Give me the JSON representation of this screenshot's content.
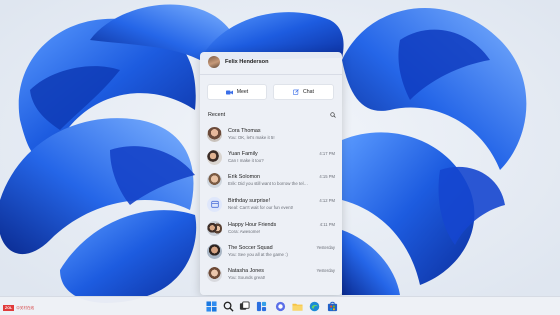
{
  "user": {
    "name": "Felix Henderson"
  },
  "actions": {
    "meet_label": "Meet",
    "chat_label": "Chat"
  },
  "recent": {
    "title": "Recent"
  },
  "chats": [
    {
      "name": "Cora Thomas",
      "message": "You: OK, let's make it 5!",
      "time": ""
    },
    {
      "name": "Yuan Family",
      "message": "Can I make it too?",
      "time": "4:17 PM"
    },
    {
      "name": "Erik Solomon",
      "message": "Erik: Did you still want to borrow the telec?",
      "time": "4:15 PM"
    },
    {
      "name": "Birthday surprise!",
      "message": "Neal: Can't wait for our fun event!",
      "time": "4:12 PM"
    },
    {
      "name": "Happy Hour Friends",
      "message": "Cora: Awesome!",
      "time": "4:11 PM"
    },
    {
      "name": "The Soccer Squad",
      "message": "You: See you all at the game :)",
      "time": "Yesterday"
    },
    {
      "name": "Natasha Jones",
      "message": "You: Sounds great!",
      "time": "Yesterday"
    }
  ],
  "watermark": {
    "badge": "ZOL",
    "text": "中关村在线"
  },
  "colors": {
    "accent": "#3a6ee8",
    "wallpaper_bg": "#e7edf5",
    "petal": "#1f5fe0"
  }
}
